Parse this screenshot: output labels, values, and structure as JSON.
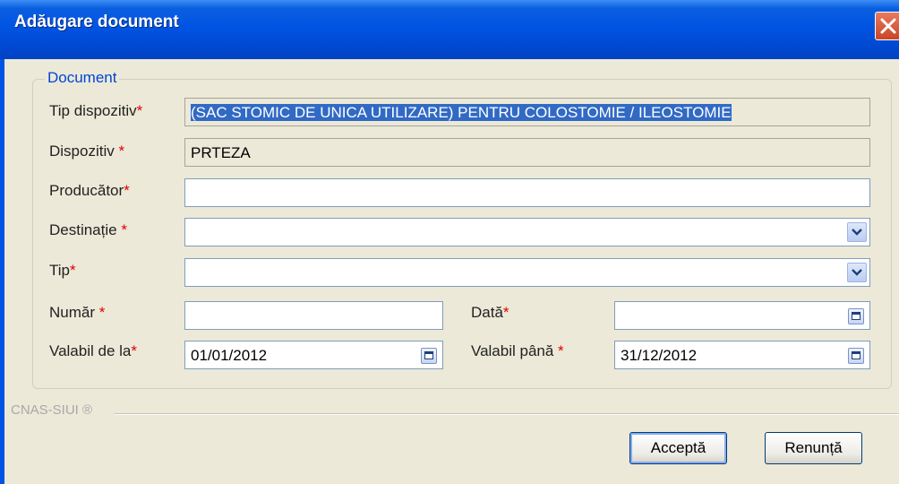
{
  "window": {
    "title": "Adăugare document"
  },
  "group": {
    "legend": "Document"
  },
  "fields": {
    "tip_dispozitiv": {
      "label": "Tip dispozitiv",
      "value": "(SAC STOMIC DE UNICA UTILIZARE) PENTRU COLOSTOMIE / ILEOSTOMIE"
    },
    "dispozitiv": {
      "label": "Dispozitiv ",
      "value": "PRTEZA"
    },
    "producator": {
      "label": "Producător",
      "value": ""
    },
    "destinatie": {
      "label": "Destinație ",
      "value": ""
    },
    "tip": {
      "label": "Tip",
      "value": ""
    },
    "numar": {
      "label": "Număr ",
      "value": ""
    },
    "data": {
      "label": "Dată",
      "value": ""
    },
    "valabil_de_la": {
      "label": "Valabil de la",
      "value": "01/01/2012"
    },
    "valabil_pana": {
      "label": "Valabil până ",
      "value": "31/12/2012"
    }
  },
  "required_mark": "*",
  "footer": {
    "brand": "CNAS-SIUI ®"
  },
  "buttons": {
    "accept": "Acceptă",
    "cancel": "Renunță"
  },
  "colors": {
    "titlebar": "#0054e3",
    "required": "#e00000",
    "legend": "#0046d5",
    "selection": "#316ac5"
  },
  "icons": {
    "close": "close-icon",
    "dropdown": "chevron-down-icon",
    "calendar": "calendar-icon"
  }
}
